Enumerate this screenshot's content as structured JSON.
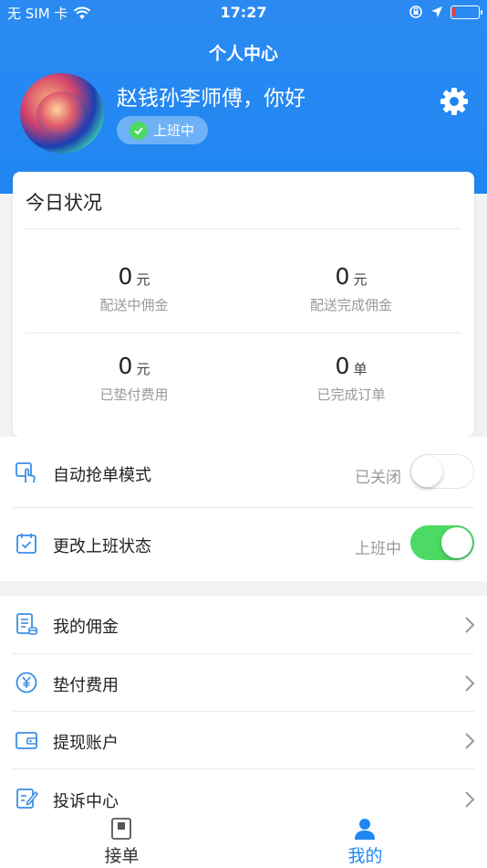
{
  "status_bar": {
    "carrier": "无 SIM 卡",
    "time": "17:27",
    "battery_level": 0.12
  },
  "nav": {
    "title": "个人中心"
  },
  "profile": {
    "greeting": "赵钱孙李师傅，你好",
    "duty_status": "上班中"
  },
  "today": {
    "title": "今日状况",
    "stats": [
      {
        "value": "0",
        "unit": "元",
        "label": "配送中佣金"
      },
      {
        "value": "0",
        "unit": "元",
        "label": "配送完成佣金"
      },
      {
        "value": "0",
        "unit": "元",
        "label": "已垫付费用"
      },
      {
        "value": "0",
        "unit": "单",
        "label": "已完成订单"
      }
    ]
  },
  "toggles": [
    {
      "label": "自动抢单模式",
      "status": "已关闭",
      "on": false,
      "icon": "hand-pointer-icon"
    },
    {
      "label": "更改上班状态",
      "status": "上班中",
      "on": true,
      "icon": "calendar-check-icon"
    }
  ],
  "menu": [
    {
      "label": "我的佣金",
      "icon": "commission-list-icon"
    },
    {
      "label": "垫付费用",
      "icon": "yen-circle-icon"
    },
    {
      "label": "提现账户",
      "icon": "wallet-icon"
    },
    {
      "label": "投诉中心",
      "icon": "edit-note-icon"
    }
  ],
  "tabbar": {
    "tabs": [
      {
        "label": "接单",
        "icon": "order-icon",
        "active": false
      },
      {
        "label": "我的",
        "icon": "person-icon",
        "active": true
      }
    ]
  },
  "colors": {
    "brand_blue": "#1f86f1",
    "toggle_on": "#4cd964",
    "icon_blue": "#3a8ee6",
    "text_muted": "#999999"
  }
}
